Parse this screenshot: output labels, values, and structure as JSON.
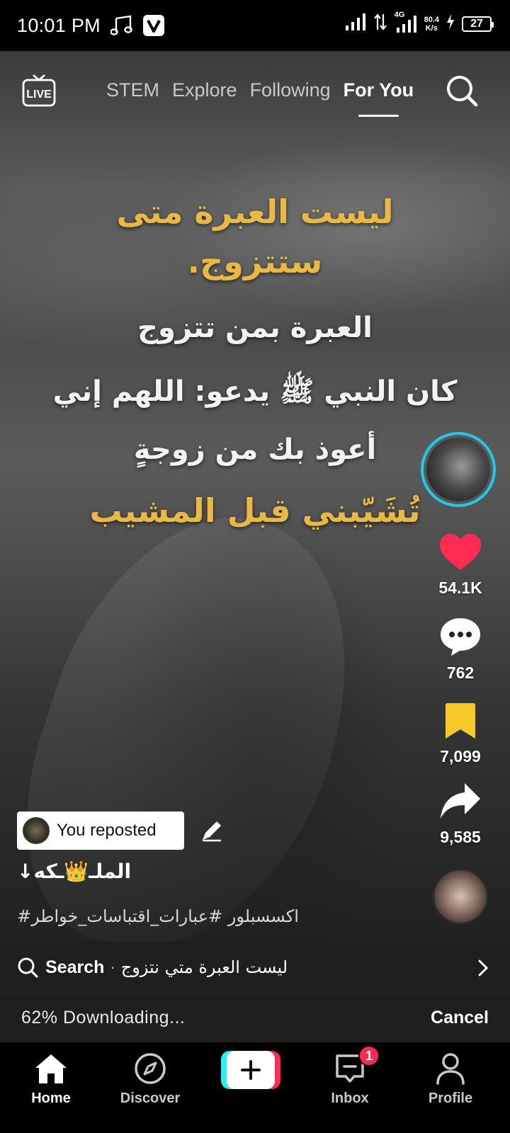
{
  "status_bar": {
    "time": "10:01 PM",
    "net_speed_value": "80.4",
    "net_speed_unit": "K/s",
    "network_type": "4G",
    "battery_level": "27"
  },
  "top_nav": {
    "live_label": "LIVE",
    "tabs": [
      {
        "label": "STEM"
      },
      {
        "label": "Explore"
      },
      {
        "label": "Following"
      },
      {
        "label": "For You"
      }
    ],
    "active_tab": "For You"
  },
  "video": {
    "overlay_lines": [
      "ليست العبرة متى",
      "ستتزوج.",
      "العبرة بمن تتزوج",
      "كان النبي ﷺ يدعو: اللهم إني",
      "أعوذ بك من زوجةٍ",
      "تُشَيّبني قبل المشيب"
    ],
    "colors": {
      "gold": "#e9b943",
      "white": "#f3f3f3"
    }
  },
  "actions": {
    "likes": "54.1K",
    "comments": "762",
    "saves": "7,099",
    "shares": "9,585",
    "like_color": "#fe2c55",
    "save_color": "#f8c829",
    "avatar_ring_color": "#24c7e6"
  },
  "post": {
    "repost_label": "You reposted",
    "username": "↓الملـ👑ـكه",
    "hashtags": "#اكسسبلور #عبارات_اقتباسات_خواطر"
  },
  "search_suggestion": {
    "label": "Search",
    "separator": "·",
    "query": "ليست العبرة متي نتزوج"
  },
  "download": {
    "status": "62% Downloading...",
    "cancel_label": "Cancel"
  },
  "bottom_nav": {
    "items": [
      {
        "label": "Home",
        "icon": "home-icon"
      },
      {
        "label": "Discover",
        "icon": "compass-icon"
      },
      {
        "label": "",
        "icon": "plus-icon"
      },
      {
        "label": "Inbox",
        "icon": "inbox-icon"
      },
      {
        "label": "Profile",
        "icon": "profile-icon"
      }
    ],
    "inbox_badge": "1",
    "accent_colors": {
      "cyan": "#25f4ee",
      "red": "#fe2c55"
    }
  }
}
